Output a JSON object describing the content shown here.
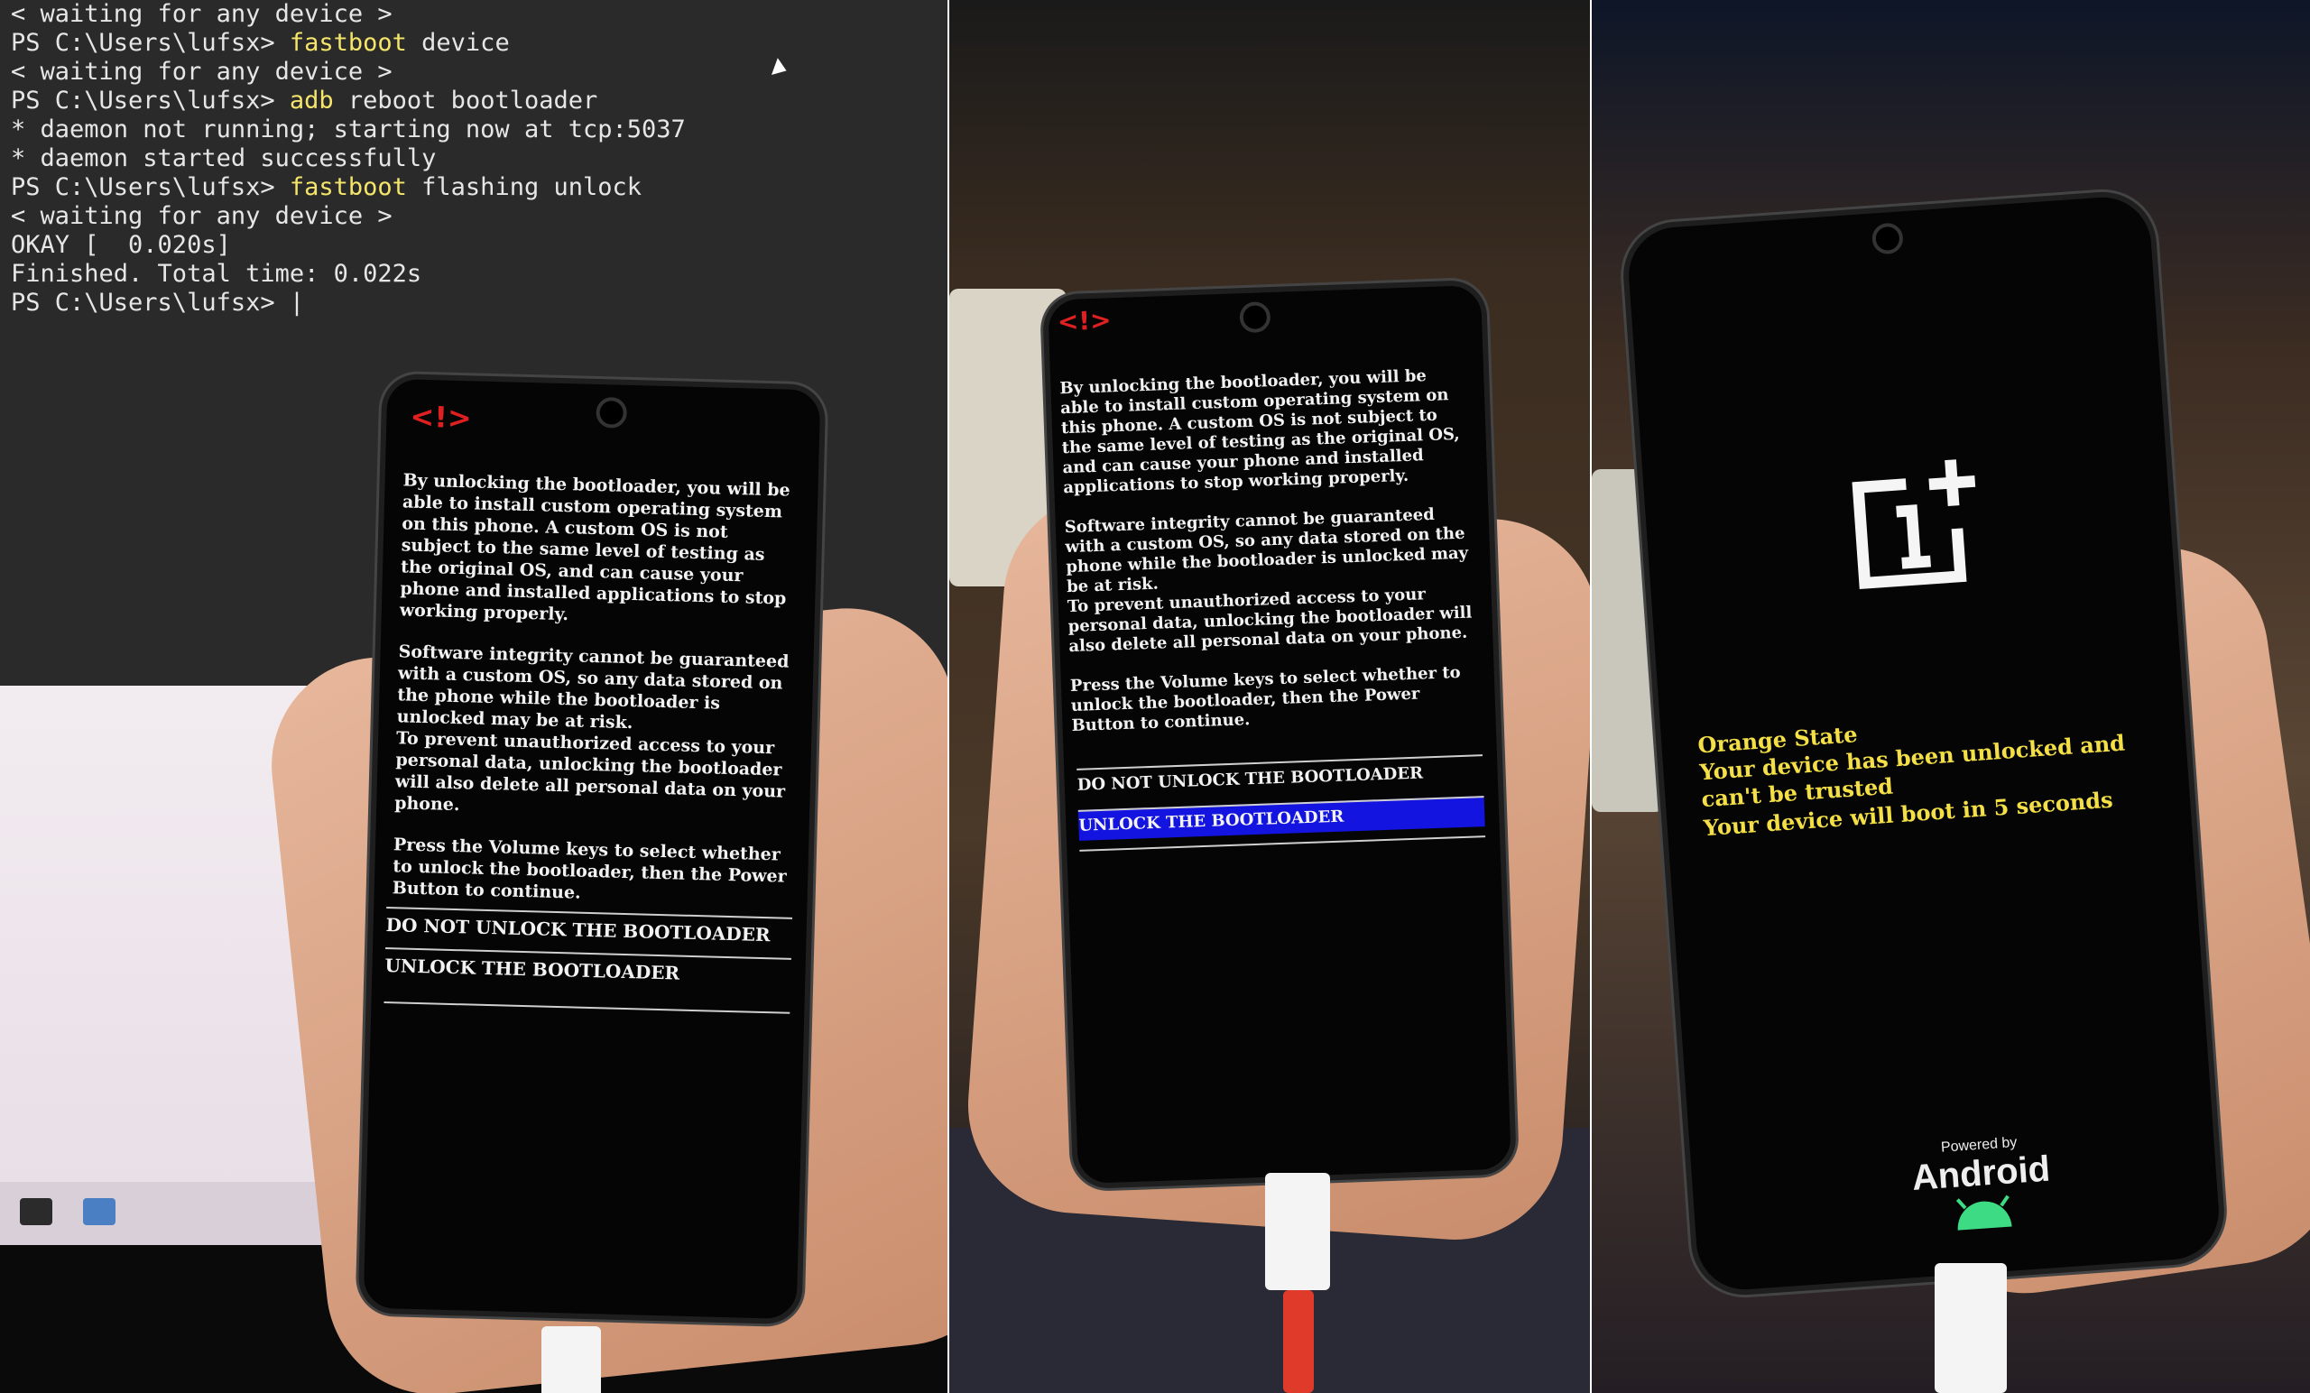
{
  "terminal": {
    "lines": [
      {
        "pre": "< waiting for any device >",
        "kw": "",
        "post": ""
      },
      {
        "pre": "PS C:\\Users\\lufsx> ",
        "kw": "fastboot",
        "post": " device"
      },
      {
        "pre": "< waiting for any device >",
        "kw": "",
        "post": ""
      },
      {
        "pre": "PS C:\\Users\\lufsx> ",
        "kw": "adb",
        "post": " reboot bootloader"
      },
      {
        "pre": "* daemon not running; starting now at tcp:5037",
        "kw": "",
        "post": ""
      },
      {
        "pre": "* daemon started successfully",
        "kw": "",
        "post": ""
      },
      {
        "pre": "PS C:\\Users\\lufsx> ",
        "kw": "fastboot",
        "post": " flashing unlock"
      },
      {
        "pre": "< waiting for any device >",
        "kw": "",
        "post": ""
      },
      {
        "pre": "OKAY [  0.020s]",
        "kw": "",
        "post": ""
      },
      {
        "pre": "Finished. Total time: 0.022s",
        "kw": "",
        "post": ""
      },
      {
        "pre": "PS C:\\Users\\lufsx> |",
        "kw": "",
        "post": ""
      }
    ]
  },
  "bootloader": {
    "warning_icon": "<!>",
    "para1": "By unlocking the bootloader, you will be able to install custom operating system on this phone. A custom OS is not subject to the same level of testing as the original OS, and can cause your phone and installed applications to stop working properly.",
    "para2": "Software integrity cannot be guaranteed with a custom OS, so any data stored on the phone while the bootloader is unlocked may be at risk.",
    "para3": "To prevent unauthorized access to your personal data, unlocking the bootloader will also delete all personal data on your phone.",
    "para4": "Press the Volume keys to select whether to unlock the bootloader, then the Power Button to continue.",
    "option_keep": "DO NOT UNLOCK THE BOOTLOADER",
    "option_unlock": "UNLOCK THE BOOTLOADER"
  },
  "boot_screen": {
    "state_title": "Orange State",
    "line1": "Your device has been unlocked and can't be trusted",
    "line2": "Your device will boot in 5 seconds",
    "powered_by": "Powered by",
    "android": "Android"
  },
  "colors": {
    "terminal_keyword": "#f5e56a",
    "warning_red": "#e02020",
    "selection_blue": "#1414e0",
    "orange_state_text": "#f4e046",
    "android_green": "#3ddc84"
  },
  "icons": [
    "warning-icon",
    "oneplus-logo",
    "android-bot-icon",
    "terminal-icon",
    "mouse-cursor-icon"
  ]
}
